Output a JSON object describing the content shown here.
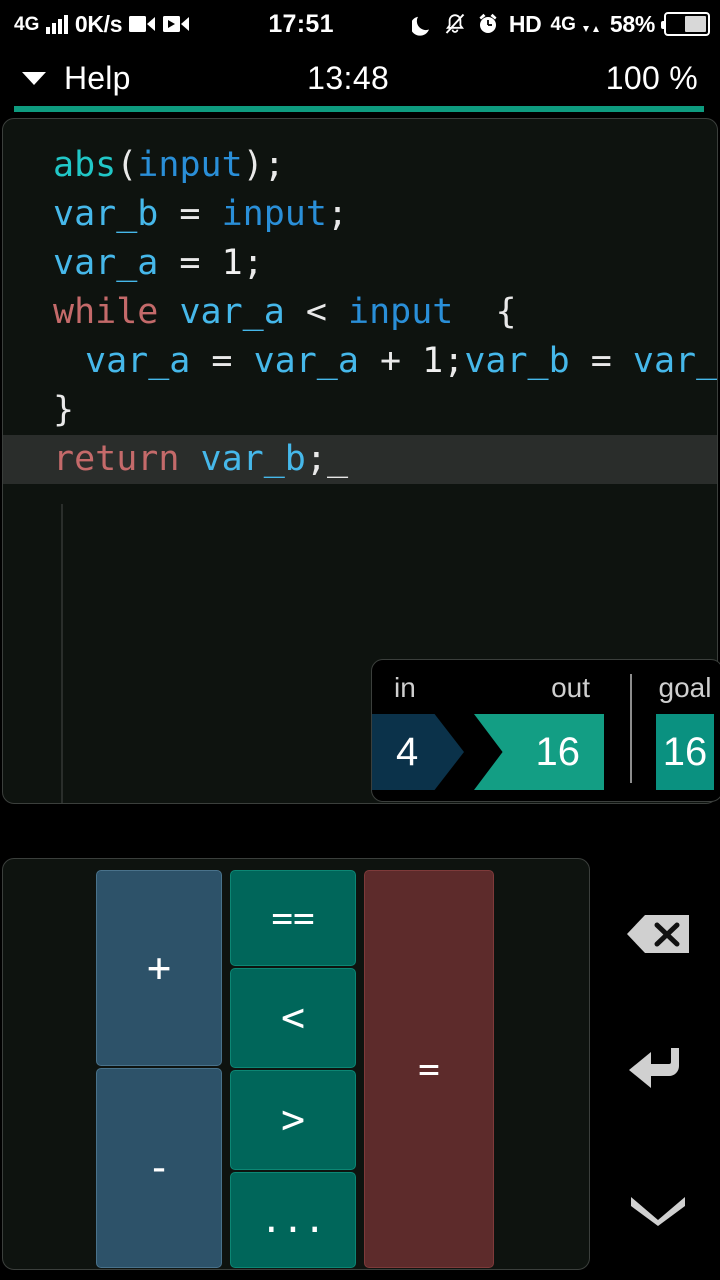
{
  "status_bar": {
    "network_type": "4G",
    "data_rate": "0K/s",
    "clock": "17:51",
    "hd_label": "HD",
    "network_type_right": "4G",
    "battery_percent": "58%",
    "icons": [
      "signal-bars-icon",
      "camera-icon",
      "video-icon",
      "moon-dnd-icon",
      "bell-muted-icon",
      "alarm-clock-icon",
      "data-arrows-icon",
      "battery-icon"
    ]
  },
  "header": {
    "help_label": "Help",
    "timer": "13:48",
    "percent": "100 %",
    "caret_icon": "chevron-down-icon"
  },
  "progress": {
    "value": "100",
    "color": "#0e9b7f"
  },
  "editor": {
    "lines": [
      {
        "id": "line-1",
        "indent": 0,
        "current": false,
        "tokens": [
          {
            "text": "abs",
            "type": "fn"
          },
          {
            "text": "(",
            "type": "punct"
          },
          {
            "text": "input",
            "type": "param"
          },
          {
            "text": ")",
            "type": "punct"
          },
          {
            "text": ";",
            "type": "punct"
          }
        ]
      },
      {
        "id": "line-2",
        "indent": 0,
        "current": false,
        "tokens": [
          {
            "text": "var_b",
            "type": "var"
          },
          {
            "text": " = ",
            "type": "op"
          },
          {
            "text": "input",
            "type": "param"
          },
          {
            "text": ";",
            "type": "punct"
          }
        ]
      },
      {
        "id": "line-3",
        "indent": 0,
        "current": false,
        "tokens": [
          {
            "text": "var_a",
            "type": "var"
          },
          {
            "text": " = ",
            "type": "op"
          },
          {
            "text": "1",
            "type": "num"
          },
          {
            "text": ";",
            "type": "punct"
          }
        ]
      },
      {
        "id": "line-4",
        "indent": 0,
        "current": false,
        "tokens": [
          {
            "text": "while",
            "type": "kw"
          },
          {
            "text": " ",
            "type": "op"
          },
          {
            "text": "var_a",
            "type": "var"
          },
          {
            "text": " < ",
            "type": "op"
          },
          {
            "text": "input",
            "type": "param"
          },
          {
            "text": "  {",
            "type": "punct"
          }
        ]
      },
      {
        "id": "line-5",
        "indent": 1,
        "current": false,
        "tokens": [
          {
            "text": "var_a",
            "type": "var"
          },
          {
            "text": " = ",
            "type": "op"
          },
          {
            "text": "var_a",
            "type": "var"
          },
          {
            "text": " + ",
            "type": "op"
          },
          {
            "text": "1",
            "type": "num"
          },
          {
            "text": ";",
            "type": "punct"
          },
          {
            "text": "var_b",
            "type": "var"
          },
          {
            "text": " = ",
            "type": "op"
          },
          {
            "text": "var_b",
            "type": "var"
          }
        ]
      },
      {
        "id": "line-6",
        "indent": 0,
        "current": false,
        "tokens": [
          {
            "text": "}",
            "type": "punct"
          }
        ]
      },
      {
        "id": "line-7",
        "indent": 0,
        "current": true,
        "tokens": [
          {
            "text": "return",
            "type": "kw"
          },
          {
            "text": " ",
            "type": "op"
          },
          {
            "text": "var_b",
            "type": "var"
          },
          {
            "text": ";",
            "type": "punct"
          },
          {
            "text": "_",
            "type": "cursor"
          }
        ]
      }
    ]
  },
  "io_panel": {
    "in_label": "in",
    "out_label": "out",
    "goal_label": "goal",
    "in_value": "4",
    "out_value": "16",
    "goal_value": "16",
    "in_color": "#0b324a",
    "out_color": "#139e84",
    "goal_color": "#0a9180"
  },
  "palette": {
    "keys": [
      {
        "id": "key-plus",
        "label": "+",
        "color": "blue"
      },
      {
        "id": "key-minus",
        "label": "-",
        "color": "blue"
      },
      {
        "id": "key-eqeq",
        "label": "==",
        "color": "green"
      },
      {
        "id": "key-lt",
        "label": "<",
        "color": "green"
      },
      {
        "id": "key-gt",
        "label": ">",
        "color": "green"
      },
      {
        "id": "key-dots",
        "label": "...",
        "color": "green"
      },
      {
        "id": "key-eq",
        "label": "=",
        "color": "red"
      }
    ],
    "blue_color": "#2d5269",
    "green_color": "#00665a",
    "red_color": "#5d2b2b"
  },
  "actions": [
    {
      "id": "backspace",
      "icon": "backspace-icon"
    },
    {
      "id": "enter",
      "icon": "enter-return-icon"
    },
    {
      "id": "collapse",
      "icon": "chevron-down-icon"
    }
  ]
}
